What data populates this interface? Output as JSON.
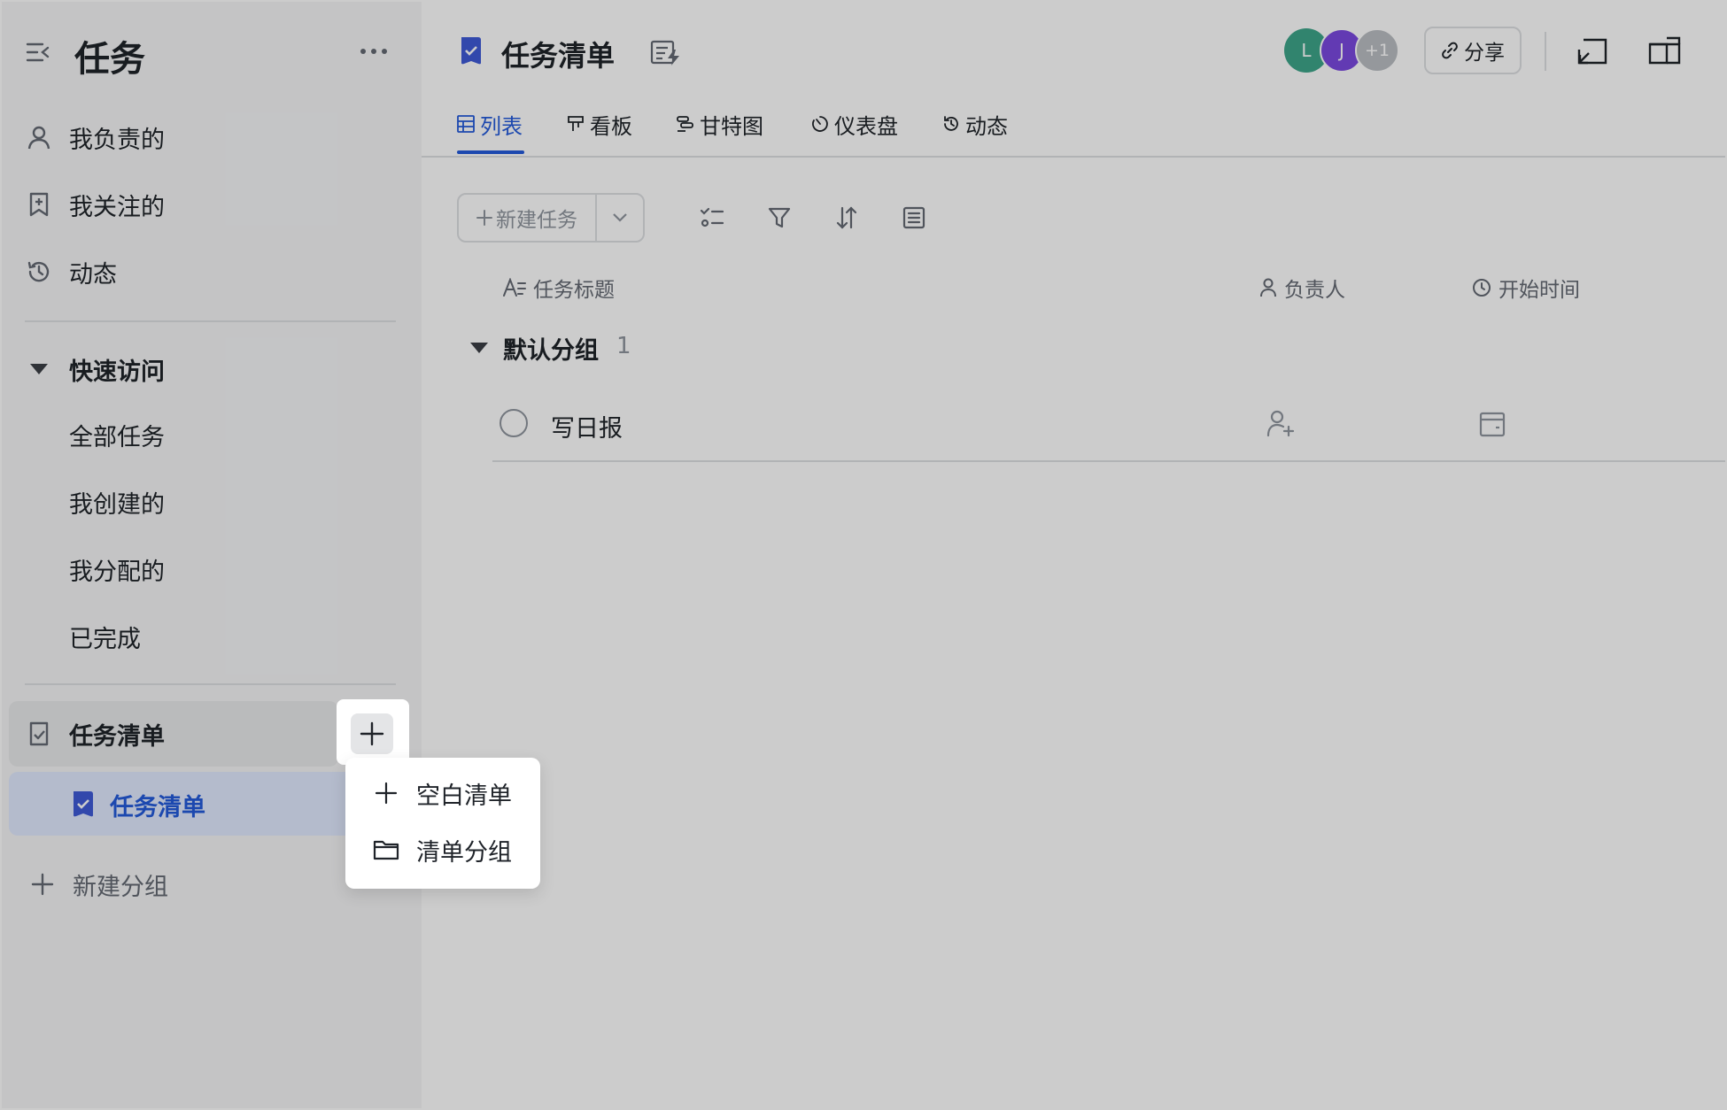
{
  "sidebar": {
    "title": "任务",
    "items": [
      {
        "label": "我负责的",
        "icon": "person-icon"
      },
      {
        "label": "我关注的",
        "icon": "bookmark-icon"
      },
      {
        "label": "动态",
        "icon": "history-icon"
      }
    ],
    "quick_access": {
      "label": "快速访问",
      "items": [
        "全部任务",
        "我创建的",
        "我分配的",
        "已完成"
      ]
    },
    "tasklist_group": {
      "label": "任务清单"
    },
    "tasklist_item": {
      "label": "任务清单"
    },
    "new_group": {
      "label": "新建分组"
    }
  },
  "header": {
    "title": "任务清单",
    "avatars": [
      {
        "initial": "L",
        "color": "#3ea58a"
      },
      {
        "initial": "J",
        "color": "#7b49e0"
      }
    ],
    "avatar_more": "+1",
    "share_label": "分享"
  },
  "tabs": [
    {
      "label": "列表",
      "active": true
    },
    {
      "label": "看板"
    },
    {
      "label": "甘特图"
    },
    {
      "label": "仪表盘"
    },
    {
      "label": "动态"
    }
  ],
  "toolbar": {
    "new_task_label": "新建任务"
  },
  "columns": {
    "title": "任务标题",
    "assignee": "负责人",
    "start_time": "开始时间"
  },
  "groups": [
    {
      "name": "默认分组",
      "count": "1",
      "tasks": [
        {
          "title": "写日报"
        }
      ]
    }
  ],
  "popover": {
    "items": [
      {
        "label": "空白清单",
        "icon": "plus-icon"
      },
      {
        "label": "清单分组",
        "icon": "folder-icon"
      }
    ]
  },
  "colors": {
    "accent": "#245bdb",
    "sidebar_bg": "#f5f6f7",
    "active_bg": "#e1eaff"
  }
}
